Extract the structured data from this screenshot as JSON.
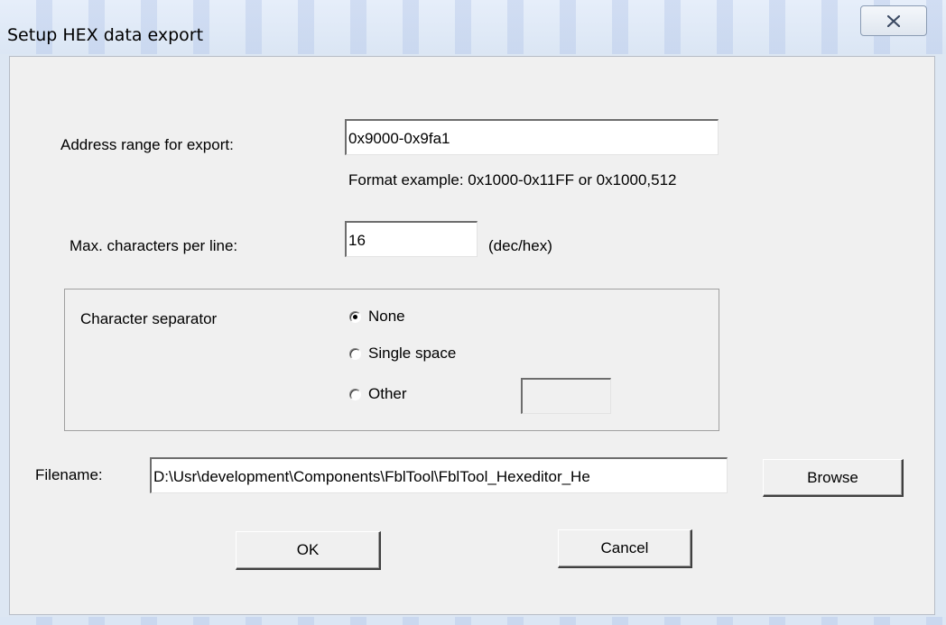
{
  "window": {
    "title": "Setup HEX data export",
    "close_icon": "close-x-icon"
  },
  "address": {
    "label": "Address range for export:",
    "value": "0x9000-0x9fa1",
    "hint": "Format example: 0x1000-0x11FF or 0x1000,512"
  },
  "max_chars": {
    "label": "Max. characters per line:",
    "value": "16",
    "unit": "(dec/hex)"
  },
  "separator": {
    "label": "Character separator",
    "options": [
      {
        "label": "None",
        "checked": true
      },
      {
        "label": "Single space",
        "checked": false
      },
      {
        "label": "Other",
        "checked": false
      }
    ],
    "other_value": ""
  },
  "filename": {
    "label": "Filename:",
    "value": "D:\\Usr\\development\\Components\\FblTool\\FblTool_Hexeditor_He",
    "browse_label": "Browse"
  },
  "buttons": {
    "ok_label": "OK",
    "cancel_label": "Cancel"
  }
}
